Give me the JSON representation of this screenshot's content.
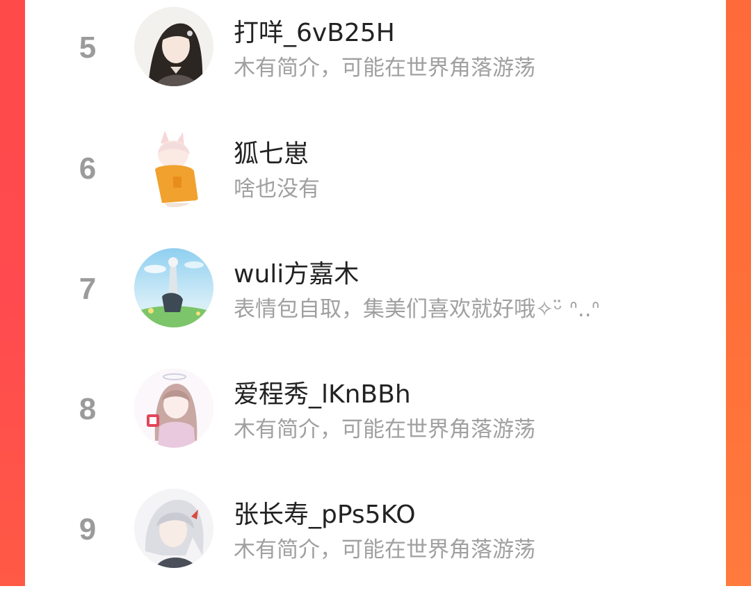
{
  "accent": {
    "left_edge": "#ff4a4a",
    "right_edge": "#ff7a3c"
  },
  "ranking": {
    "items": [
      {
        "rank": "5",
        "name": "打咩_6vB25H",
        "bio": "木有简介，可能在世界角落游荡",
        "avatar_icon": "dark-haired-character-avatar"
      },
      {
        "rank": "6",
        "name": "狐七崽",
        "bio": "啥也没有",
        "avatar_icon": "fox-ear-character-avatar"
      },
      {
        "rank": "7",
        "name": "wuli方嘉木",
        "bio": "表情包自取，集美们喜欢就好哦✧ᵕ̈ ᐢ..ᐢ",
        "avatar_icon": "sky-landscape-character-avatar"
      },
      {
        "rank": "8",
        "name": "爱程秀_lKnBBh",
        "bio": "木有简介，可能在世界角落游荡",
        "avatar_icon": "angel-girl-avatar"
      },
      {
        "rank": "9",
        "name": "张长寿_pPs5KO",
        "bio": "木有简介，可能在世界角落游荡",
        "avatar_icon": "white-haired-character-avatar"
      }
    ]
  }
}
